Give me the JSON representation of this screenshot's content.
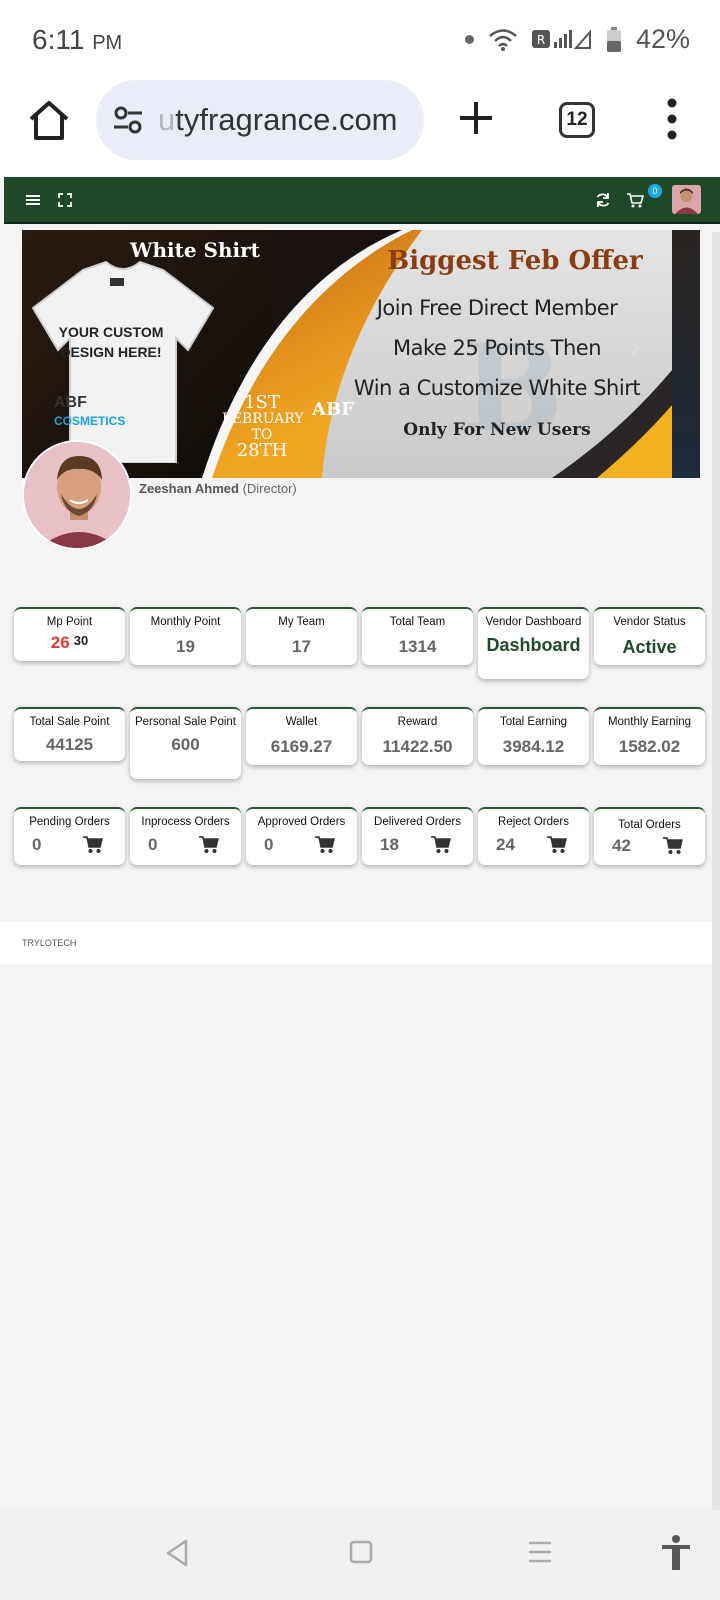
{
  "status": {
    "time": "6:11",
    "ampm": "PM",
    "battery": "42%"
  },
  "browser": {
    "url_faded": "u",
    "url": "tyfragrance.com",
    "tab_count": "12"
  },
  "header": {
    "cart_count": "0"
  },
  "banner": {
    "shirt_title": "White Shirt",
    "custom_text": "YOUR CUSTOM DESIGN HERE!",
    "brand": "ABF",
    "brand_sub": "COSMETICS",
    "date_start": "1ST",
    "date_month": "FEBRUARY",
    "date_to": "TO",
    "date_end": "28TH",
    "vertical": "ABF",
    "offer_title": "Biggest Feb Offer",
    "line1": "Join Free Direct Member",
    "line2": "Make 25 Points Then",
    "line3": "Win a Customize White Shirt",
    "line4": "Only For New Users"
  },
  "profile": {
    "name": "Zeeshan Ahmed",
    "role": "(Director)"
  },
  "stats_row1": [
    {
      "label": "Mp Point",
      "value": "26",
      "sup": "30"
    },
    {
      "label": "Monthly Point",
      "value": "19"
    },
    {
      "label": "My Team",
      "value": "17"
    },
    {
      "label": "Total Team",
      "value": "1314"
    },
    {
      "label": "Vendor Dashboard",
      "value": "Dashboard"
    },
    {
      "label": "Vendor Status",
      "value": "Active"
    }
  ],
  "stats_row2": [
    {
      "label": "Total Sale Point",
      "value": "44125"
    },
    {
      "label": "Personal Sale Point",
      "value": "600"
    },
    {
      "label": "Wallet",
      "value": "6169.27"
    },
    {
      "label": "Reward",
      "value": "11422.50"
    },
    {
      "label": "Total Earning",
      "value": "3984.12"
    },
    {
      "label": "Monthly Earning",
      "value": "1582.02"
    }
  ],
  "orders": [
    {
      "label": "Pending Orders",
      "value": "0"
    },
    {
      "label": "Inprocess Orders",
      "value": "0"
    },
    {
      "label": "Approved Orders",
      "value": "0"
    },
    {
      "label": "Delivered Orders",
      "value": "18"
    },
    {
      "label": "Reject Orders",
      "value": "24"
    },
    {
      "label": "Total Orders",
      "value": "42"
    }
  ],
  "footer": {
    "text": "TRYLOTECH"
  },
  "colors": {
    "header_green": "#1e4a2a",
    "mp_red": "#e23b3b",
    "badge_blue": "#1aa8e6"
  }
}
